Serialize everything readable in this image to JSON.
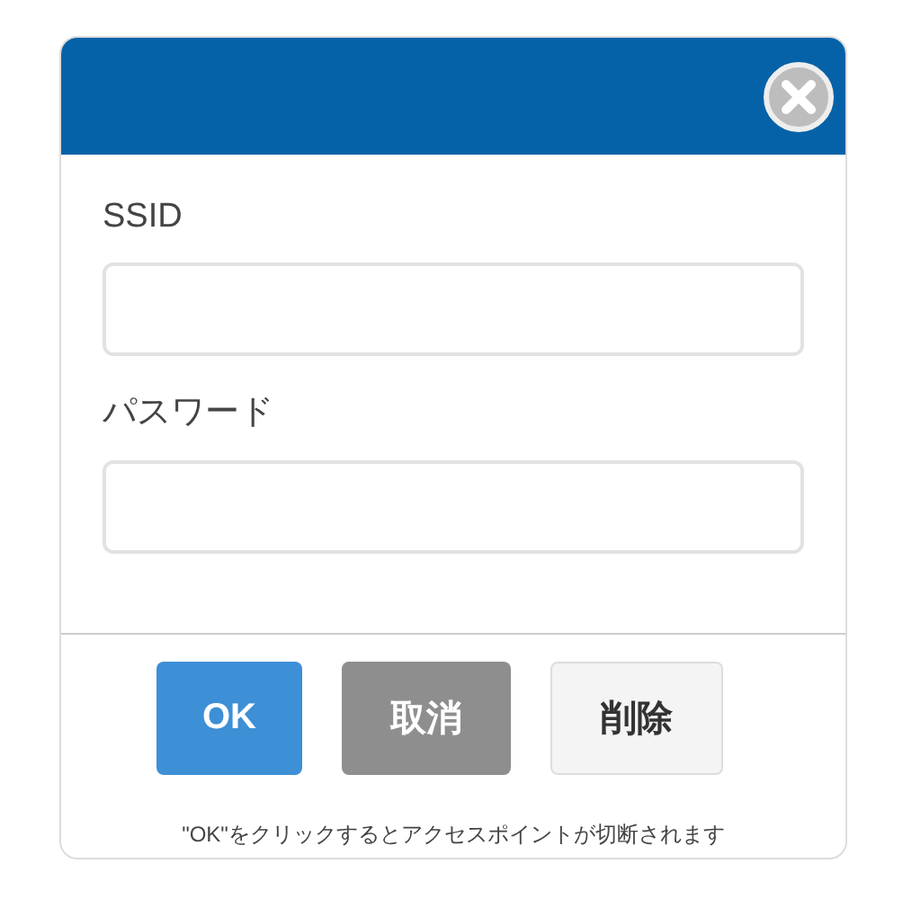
{
  "fields": [
    {
      "label": "SSID"
    },
    {
      "label": "パスワード"
    }
  ],
  "buttons": [
    {
      "label": "OK",
      "kind": "primary"
    },
    {
      "label": "取消",
      "kind": "secondary"
    },
    {
      "label": "削除",
      "kind": "plain"
    }
  ],
  "note": "\"OK\"をクリックするとアクセスポイントが切断されます"
}
